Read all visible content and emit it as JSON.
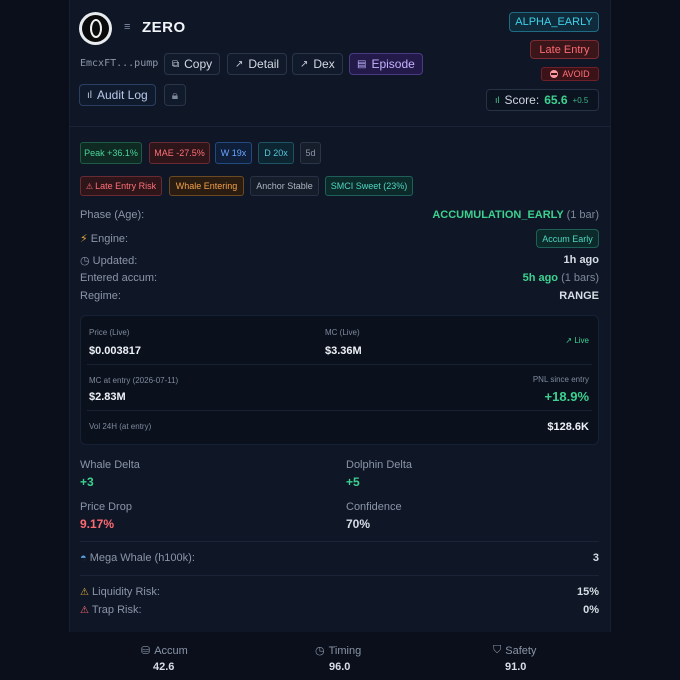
{
  "header": {
    "title": "ZERO",
    "address": "EmcxFT...pump",
    "buttons": {
      "copy": "Copy",
      "detail": "Detail",
      "dex": "Dex",
      "episode": "Episode",
      "audit_log": "Audit Log"
    },
    "badges": {
      "alpha": "ALPHA_EARLY",
      "late_entry": "Late Entry",
      "avoid": "AVOID"
    },
    "score": {
      "label": "Score:",
      "value": "65.6",
      "delta": "+0.5"
    }
  },
  "metric_pills": [
    "Peak +36.1%",
    "MAE -27.5%",
    "W 19x",
    "D 20x",
    "5d"
  ],
  "tag_pills": [
    "Late Entry Risk",
    "Whale Entering",
    "Anchor Stable",
    "SMCI Sweet (23%)"
  ],
  "details": {
    "phase": {
      "label": "Phase (Age):",
      "value": "ACCUMULATION_EARLY",
      "extra": "(1 bar)"
    },
    "engine": {
      "label": "Engine:",
      "value": "Accum Early"
    },
    "updated": {
      "label": "Updated:",
      "value": "1h ago"
    },
    "entered": {
      "label": "Entered accum:",
      "value": "5h ago",
      "extra": "(1 bars)"
    },
    "regime": {
      "label": "Regime:",
      "value": "RANGE"
    }
  },
  "price_box": {
    "price_label": "Price (Live)",
    "price": "$0.003817",
    "mc_label": "MC (Live)",
    "mc": "$3.36M",
    "live": "Live",
    "mc_entry_label": "MC at entry (2026-07-11)",
    "mc_entry": "$2.83M",
    "pnl_label": "PNL since entry",
    "pnl": "+18.9%",
    "vol_label": "Vol 24H (at entry)",
    "vol": "$128.6K"
  },
  "stats": {
    "whale_delta": {
      "label": "Whale Delta",
      "value": "+3"
    },
    "dolphin_delta": {
      "label": "Dolphin Delta",
      "value": "+5"
    },
    "price_drop": {
      "label": "Price Drop",
      "value": "9.17%"
    },
    "confidence": {
      "label": "Confidence",
      "value": "70%"
    }
  },
  "mega_whale": {
    "label": "Mega Whale (h100k):",
    "value": "3"
  },
  "risks": {
    "liquidity": {
      "label": "Liquidity Risk:",
      "value": "15%"
    },
    "trap": {
      "label": "Trap Risk:",
      "value": "0%"
    }
  },
  "footer": {
    "accum": {
      "label": "Accum",
      "value": "42.6"
    },
    "timing": {
      "label": "Timing",
      "value": "96.0"
    },
    "safety": {
      "label": "Safety",
      "value": "91.0"
    }
  },
  "colors": {
    "background": "#0a0f1b",
    "card": "#0f1726",
    "accent_green": "#3cd18f",
    "accent_red": "#ff6a72"
  }
}
